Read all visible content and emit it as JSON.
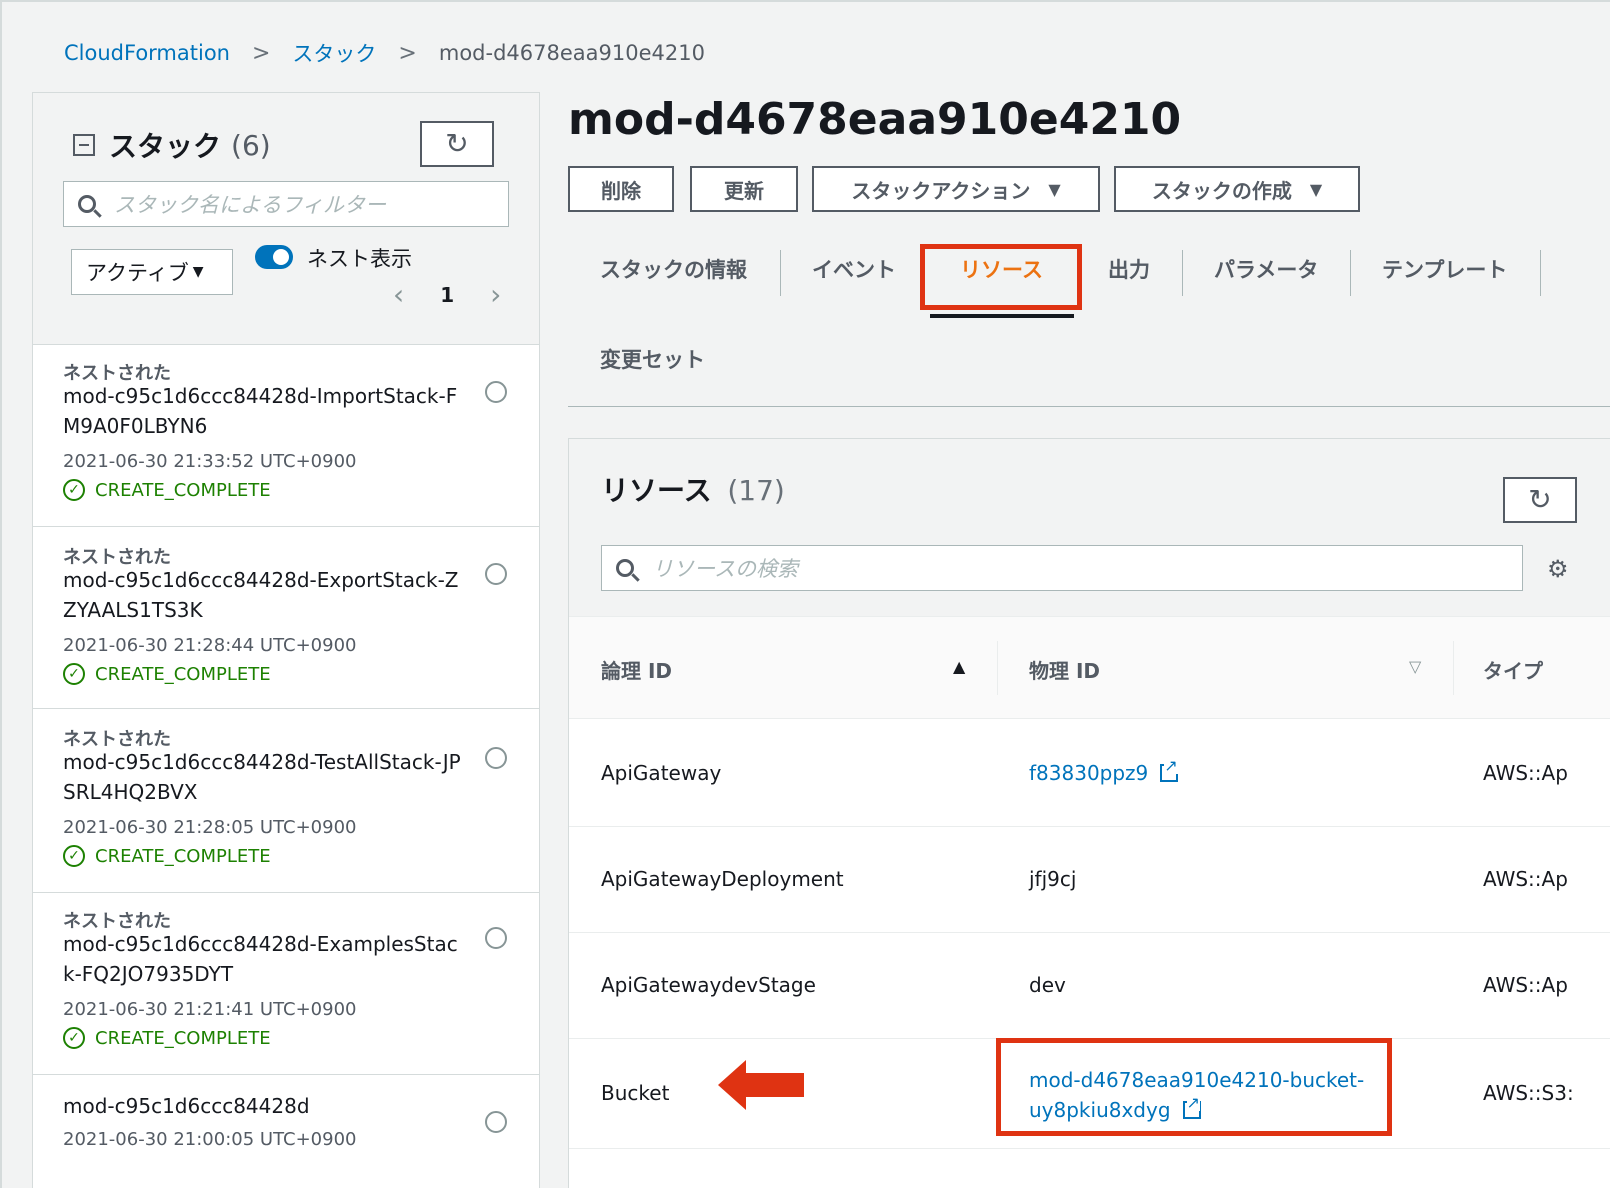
{
  "breadcrumb": {
    "root": "CloudFormation",
    "stacks": "スタック",
    "current": "mod-d4678eaa910e4210",
    "separator": ">"
  },
  "left_panel": {
    "title": "スタック",
    "count": "(6)",
    "search_placeholder": "スタック名によるフィルター",
    "filter_value": "アクティブ",
    "nested_toggle_label": "ネスト表示",
    "nested_toggle_on": true,
    "page": "1",
    "stacks": [
      {
        "tag": "ネストされた",
        "name": "mod-c95c1d6ccc84428d-ImportStack-FM9A0F0LBYN6",
        "time": "2021-06-30 21:33:52 UTC+0900",
        "status": "CREATE_COMPLETE"
      },
      {
        "tag": "ネストされた",
        "name": "mod-c95c1d6ccc84428d-ExportStack-ZZYAALS1TS3K",
        "time": "2021-06-30 21:28:44 UTC+0900",
        "status": "CREATE_COMPLETE"
      },
      {
        "tag": "ネストされた",
        "name": "mod-c95c1d6ccc84428d-TestAllStack-JPSRL4HQ2BVX",
        "time": "2021-06-30 21:28:05 UTC+0900",
        "status": "CREATE_COMPLETE"
      },
      {
        "tag": "ネストされた",
        "name": "mod-c95c1d6ccc84428d-ExamplesStack-FQ2JO7935DYT",
        "time": "2021-06-30 21:21:41 UTC+0900",
        "status": "CREATE_COMPLETE"
      },
      {
        "tag": "",
        "name": "mod-c95c1d6ccc84428d",
        "time": "2021-06-30 21:00:05 UTC+0900",
        "status": ""
      }
    ]
  },
  "main": {
    "title": "mod-d4678eaa910e4210",
    "actions": {
      "delete": "削除",
      "update": "更新",
      "stack_actions": "スタックアクション",
      "create_stack": "スタックの作成"
    },
    "tabs": {
      "info": "スタックの情報",
      "events": "イベント",
      "resources": "リソース",
      "outputs": "出力",
      "parameters": "パラメータ",
      "template": "テンプレート",
      "changesets": "変更セット"
    },
    "active_tab": "resources"
  },
  "resources": {
    "title": "リソース",
    "count": "(17)",
    "search_placeholder": "リソースの検索",
    "columns": {
      "logical_id": "論理 ID",
      "physical_id": "物理 ID",
      "type": "タイプ"
    },
    "rows": [
      {
        "logical_id": "ApiGateway",
        "physical_id": "f83830ppz9",
        "physical_link": true,
        "type": "AWS::Ap"
      },
      {
        "logical_id": "ApiGatewayDeployment",
        "physical_id": "jfj9cj",
        "physical_link": false,
        "type": "AWS::Ap"
      },
      {
        "logical_id": "ApiGatewaydevStage",
        "physical_id": "dev",
        "physical_link": false,
        "type": "AWS::Ap"
      },
      {
        "logical_id": "Bucket",
        "physical_id_line1": "mod-d4678eaa910e4210-bucket-",
        "physical_id_line2": "uy8pkiu8xdyg",
        "physical_link": true,
        "type": "AWS::S3:"
      }
    ]
  },
  "colors": {
    "link": "#0073bb",
    "active_tab": "#ec7211",
    "success": "#1d8102",
    "highlight": "#df3312"
  },
  "icons": {
    "refresh": "refresh-icon",
    "search": "search-icon",
    "settings": "gear-icon",
    "external": "external-link-icon",
    "status_ok": "check-circle-icon"
  }
}
